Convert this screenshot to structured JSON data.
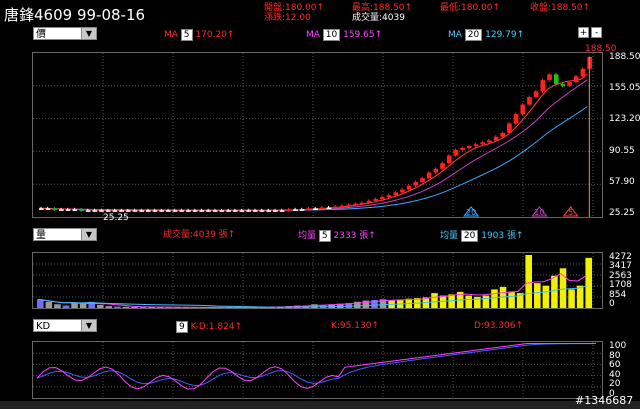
{
  "header": {
    "title": "唐鋒4609 99-08-16",
    "open_label": "開盤:180.00↑",
    "change_label": "漲跌:12.00",
    "high_label": "最高:188.50↑",
    "volume_label": "成交量:4039",
    "low_label": "最低:180.00↑",
    "close_label": "收盤:188.50↑",
    "plus_btn": "+",
    "minus_btn": "-"
  },
  "price_toolbar": {
    "select_value": "價",
    "ma1_prefix": "MA",
    "ma1_period": "5",
    "ma1_value": "170.20↑",
    "ma2_prefix": "MA",
    "ma2_period": "10",
    "ma2_value": "159.65↑",
    "ma3_prefix": "MA",
    "ma3_period": "20",
    "ma3_value": "129.79↑"
  },
  "price_axis": [
    "188.50",
    "155.05",
    "123.20",
    "90.55",
    "57.90",
    "25.25"
  ],
  "price_annotations": {
    "top_price": "188.50",
    "low_price": "25.25",
    "marker_20": "20",
    "marker_10": "10",
    "marker_5": "5"
  },
  "volume_toolbar": {
    "select_value": "量",
    "vol_label": "成交量:4039 張↑",
    "avg1_prefix": "均量",
    "avg1_period": "5",
    "avg1_value": "2333 張↑",
    "avg2_prefix": "均量",
    "avg2_period": "20",
    "avg2_value": "1903 張↑"
  },
  "volume_axis": [
    "4272",
    "3417",
    "2563",
    "1708",
    "854",
    "0"
  ],
  "kd_toolbar": {
    "select_value": "KD",
    "period": "9",
    "kd_label": "K-D:1.824↑",
    "k_label": "K:95.130↑",
    "d_label": "D:93.306↑"
  },
  "kd_axis": [
    "100",
    "80",
    "60",
    "40",
    "20",
    "0"
  ],
  "watermark": "#1346687",
  "chart_data": [
    {
      "type": "candlestick",
      "title": "唐鋒4609 99-08-16",
      "ylim": [
        25.25,
        188.5
      ],
      "series": [
        {
          "name": "close",
          "values": [
            28,
            28,
            27,
            27,
            27,
            27,
            26,
            26,
            26,
            26,
            26,
            26,
            26,
            26,
            26,
            26,
            26,
            26,
            26,
            26,
            26,
            26,
            26,
            26,
            26,
            26,
            26,
            26,
            26,
            26,
            26,
            26,
            26,
            26,
            26,
            26,
            26,
            27,
            27,
            27,
            28,
            28,
            29,
            29,
            30,
            31,
            32,
            33,
            34,
            36,
            38,
            40,
            42,
            45,
            48,
            52,
            56,
            60,
            66,
            70,
            76,
            84,
            90,
            92,
            94,
            96,
            98,
            100,
            104,
            108,
            118,
            128,
            138,
            146,
            152,
            164,
            170,
            160,
            158,
            162,
            168,
            176,
            188.5
          ]
        },
        {
          "name": "MA5",
          "values_last": 170.2
        },
        {
          "name": "MA10",
          "values_last": 159.65
        },
        {
          "name": "MA20",
          "values_last": 129.79
        }
      ]
    },
    {
      "type": "bar",
      "title": "成交量",
      "ylim": [
        0,
        4272
      ],
      "series": [
        {
          "name": "volume",
          "values": [
            700,
            500,
            300,
            200,
            450,
            350,
            500,
            250,
            150,
            120,
            100,
            90,
            80,
            80,
            70,
            60,
            60,
            50,
            50,
            50,
            50,
            50,
            50,
            50,
            50,
            50,
            60,
            80,
            100,
            150,
            200,
            200,
            300,
            250,
            300,
            350,
            400,
            500,
            600,
            650,
            700,
            600,
            650,
            750,
            800,
            850,
            1200,
            1000,
            1100,
            1300,
            1000,
            900,
            1000,
            1500,
            1700,
            1300,
            1200,
            4272,
            2000,
            1800,
            2600,
            3200,
            1500,
            1800,
            4039
          ]
        }
      ]
    },
    {
      "type": "line",
      "title": "KD",
      "ylim": [
        0,
        100
      ],
      "series": [
        {
          "name": "K",
          "values_last": 95.13
        },
        {
          "name": "D",
          "values_last": 93.306
        }
      ]
    }
  ]
}
